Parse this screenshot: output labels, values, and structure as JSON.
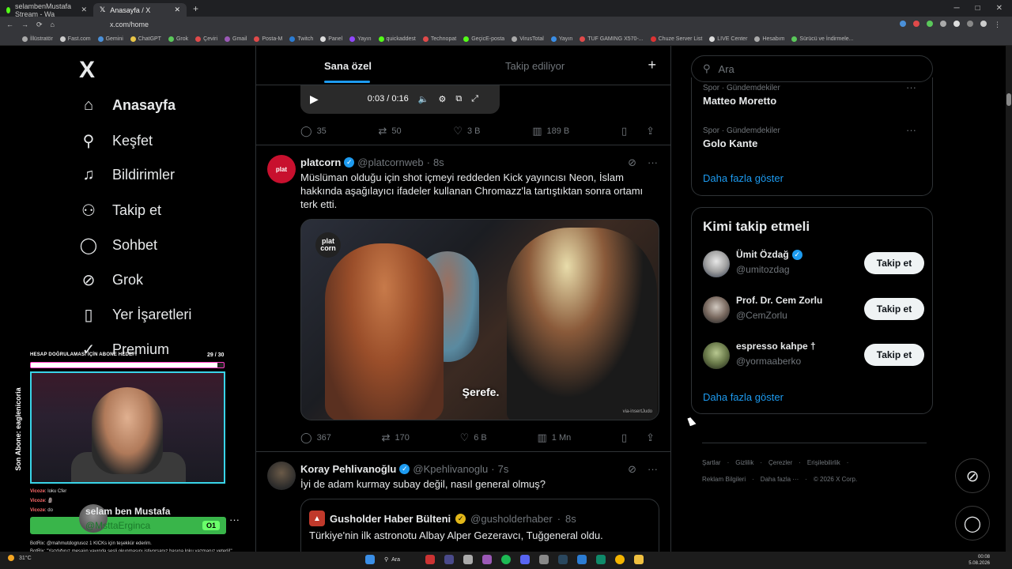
{
  "browser": {
    "tabs": [
      {
        "label": "selambenMustafa Stream - Wa",
        "active": false
      },
      {
        "label": "Anasayfa / X",
        "active": true
      }
    ],
    "url": "x.com/home",
    "bookmarks": [
      "İllüstratör",
      "Fast.com",
      "Gemini",
      "ChatGPT",
      "Grok",
      "Çeviri",
      "Gmail",
      "Posta-M",
      "Twitch",
      "Panel",
      "Yayın",
      "quickaddest",
      "Technopat",
      "GeçicE-posta",
      "VirusTotal",
      "Yayın",
      "TUF GAMING X570-...",
      "Chuze Server List",
      "LIVE Center",
      "Hesabım",
      "Sürücü ve İndirmele..."
    ]
  },
  "sidebar": {
    "logo": "X",
    "items": [
      {
        "label": "Anasayfa",
        "icon": "home-icon",
        "glyph": "⌂"
      },
      {
        "label": "Keşfet",
        "icon": "search-icon",
        "glyph": "⚲"
      },
      {
        "label": "Bildirimler",
        "icon": "bell-icon",
        "glyph": "🔔"
      },
      {
        "label": "Takip et",
        "icon": "follow-icon",
        "glyph": "👤"
      },
      {
        "label": "Sohbet",
        "icon": "chat-icon",
        "glyph": "◯"
      },
      {
        "label": "Grok",
        "icon": "grok-icon",
        "glyph": "⊘"
      },
      {
        "label": "Yer İşaretleri",
        "icon": "bookmark-icon",
        "glyph": "🔖"
      },
      {
        "label": "Premium",
        "icon": "premium-icon",
        "glyph": "✓"
      }
    ]
  },
  "timeline": {
    "tabs": [
      "Sana özel",
      "Takip ediliyor"
    ],
    "plus": "+",
    "video": {
      "time": "0:03 / 0:16"
    },
    "prev_actions": {
      "replies": "35",
      "reposts": "50",
      "likes": "3 B",
      "views": "189 B"
    },
    "tweet1": {
      "name": "platcorn",
      "handle": "@platcornweb",
      "time": "8s",
      "text": "Müslüman olduğu için shot içmeyi reddeden Kick yayıncısı Neon, İslam hakkında aşağılayıcı ifadeler kullanan Chromazz'la tartıştıktan sonra ortamı terk etti.",
      "media_logo": "plat corn",
      "caption": "Şerefe.",
      "watermark": "via-insertJudo",
      "actions": {
        "replies": "367",
        "reposts": "170",
        "likes": "6 B",
        "views": "1 Mn"
      }
    },
    "tweet2": {
      "name": "Koray Pehlivanoğlu",
      "handle": "@Kpehlivanoglu",
      "time": "7s",
      "text": "İyi de adam kurmay subay değil, nasıl general olmuş?",
      "quote": {
        "name": "Gusholder Haber Bülteni",
        "handle": "@gusholderhaber",
        "time": "8s",
        "text": "Türkiye'nin ilk astronotu Albay Alper Gezeravcı, Tuğgeneral oldu."
      }
    }
  },
  "right": {
    "search_placeholder": "Ara",
    "trends": [
      {
        "meta": "Spor · Gündemdekiler",
        "title": "Matteo Moretto"
      },
      {
        "meta": "Spor · Gündemdekiler",
        "title": "Golo Kante"
      }
    ],
    "show_more": "Daha fazla göster",
    "follow_title": "Kimi takip etmeli",
    "follows": [
      {
        "name": "Ümit Özdağ",
        "handle": "@umitozdag",
        "verified": true,
        "button": "Takip et"
      },
      {
        "name": "Prof. Dr. Cem Zorlu",
        "handle": "@CemZorlu",
        "verified": false,
        "button": "Takip et"
      },
      {
        "name": "espresso kahpe †",
        "handle": "@yormaaberko",
        "verified": false,
        "button": "Takip et"
      }
    ],
    "follow_show_more": "Daha fazla göster",
    "footer_row1": [
      "Şartlar",
      "Gizlilik",
      "Çerezler",
      "Erişilebilirlik"
    ],
    "footer_row2": [
      "Reklam Bilgileri",
      "Daha fazla ···",
      "© 2026 X Corp."
    ]
  },
  "stream_overlay": {
    "goal_title": "HESAP DOĞRULAMASI İÇİN ABONE HEDEFİ",
    "goal_count": "29 / 30",
    "goal_progress": 0.967,
    "side_label": "Son Abone: eaglenicoria",
    "chat": [
      {
        "user": "Vicoze",
        "msg": ": loku Cfer"
      },
      {
        "user": "Vicoze",
        "msg": ": 🗿"
      },
      {
        "user": "Vicoze",
        "msg": ": do"
      }
    ],
    "alert_name": "selam ben Mustafa",
    "alert_handle": "@MsttaErginca",
    "alert_badge": "O1",
    "bot_lines": [
      {
        "user": "BotRix",
        "msg": ": @mahmutdogrusoz 1 KICKs için teşekkür ederim."
      },
      {
        "user": "BotRix",
        "msg": ": \"Yazdığınız mesajın yayında sesli okunmasını istiyorsanız başına loku yazmanız yeterli!\""
      }
    ]
  },
  "taskbar": {
    "search": "Ara",
    "time": "00:08",
    "date": "5.08.2026",
    "weather": "31°C"
  }
}
